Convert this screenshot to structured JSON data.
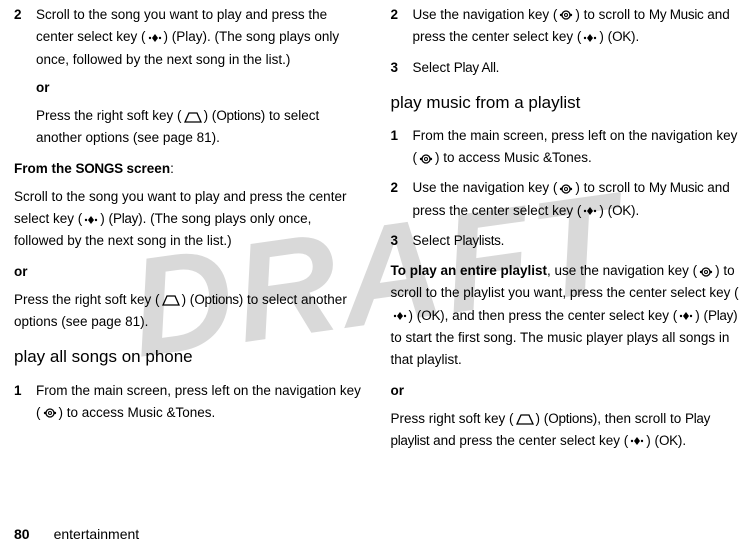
{
  "watermark": "DRAFT",
  "left": {
    "step2_num": "2",
    "step2_text_a": "Scroll to the song you want to play and press the center select key (",
    "step2_text_b": ") (Play). (The song plays only once, followed by the next song in the list.)",
    "or1": "or",
    "step2_alt_a": "Press the right soft key (",
    "step2_alt_b": ") (",
    "options_label": "Options",
    "step2_alt_c": ") to select another options (see page 81).",
    "from_songs_a": "From the ",
    "songs_label": "SONGS",
    "from_songs_b": " screen",
    "from_songs_c": ":",
    "songs_para_a": "Scroll to the song you want to play and press the center select key (",
    "songs_para_b": ") (",
    "play_label": "Play",
    "songs_para_c": "). (The song plays only once, followed by the next song in the list.)",
    "or2": "or",
    "songs_alt_a": "Press the right soft key (",
    "songs_alt_b": ") (",
    "songs_alt_c": ") to select another options (see page 81).",
    "heading": "play all songs on phone",
    "step1_num": "1",
    "step1_text_a": "From the main screen, press left on the navigation key (",
    "step1_text_b": ") to access Music &Tones."
  },
  "right": {
    "step2_num": "2",
    "step2_text_a": "Use the navigation key (",
    "step2_text_b": ") to scroll to ",
    "my_music_label": "My Music",
    "step2_text_c": " and press the center select key (",
    "step2_text_d": ") (",
    "ok_label": "OK",
    "step2_text_e": ").",
    "step3_num": "3",
    "step3_text_a": "Select ",
    "play_all_label": "Play All",
    "step3_text_b": ".",
    "heading": "play music from a playlist",
    "p_step1_num": "1",
    "p_step1_a": "From the main screen, press left on the navigation key (",
    "p_step1_b": ") to access Music &Tones.",
    "p_step2_num": "2",
    "p_step2_a": "Use the navigation key (",
    "p_step2_b": ") to scroll to ",
    "p_step2_c": " and press the center select key (",
    "p_step2_d": ") (",
    "p_step2_e": ").",
    "p_step3_num": "3",
    "p_step3_a": "Select ",
    "playlists_label": "Playlists",
    "p_step3_b": ".",
    "entire_a": "To play an entire playlist",
    "entire_b": ", use the navigation key (",
    "entire_c": ") to scroll to the playlist you want, press the center select key (",
    "entire_d": ") (",
    "entire_e": "), and then press the center select key (",
    "entire_f": ") (",
    "play_label": "Play",
    "entire_g": ") to start the first song. The music player plays all songs in that playlist.",
    "or": "or",
    "alt_a": "Press right soft key (",
    "alt_b": ") (",
    "options_label": "Options",
    "alt_c": "), then scroll to ",
    "play_playlist_label": "Play playlist",
    "alt_d": " and press the center select key (",
    "alt_e": ") (",
    "alt_f": ")."
  },
  "footer": {
    "page_num": "80",
    "section": "entertainment"
  }
}
